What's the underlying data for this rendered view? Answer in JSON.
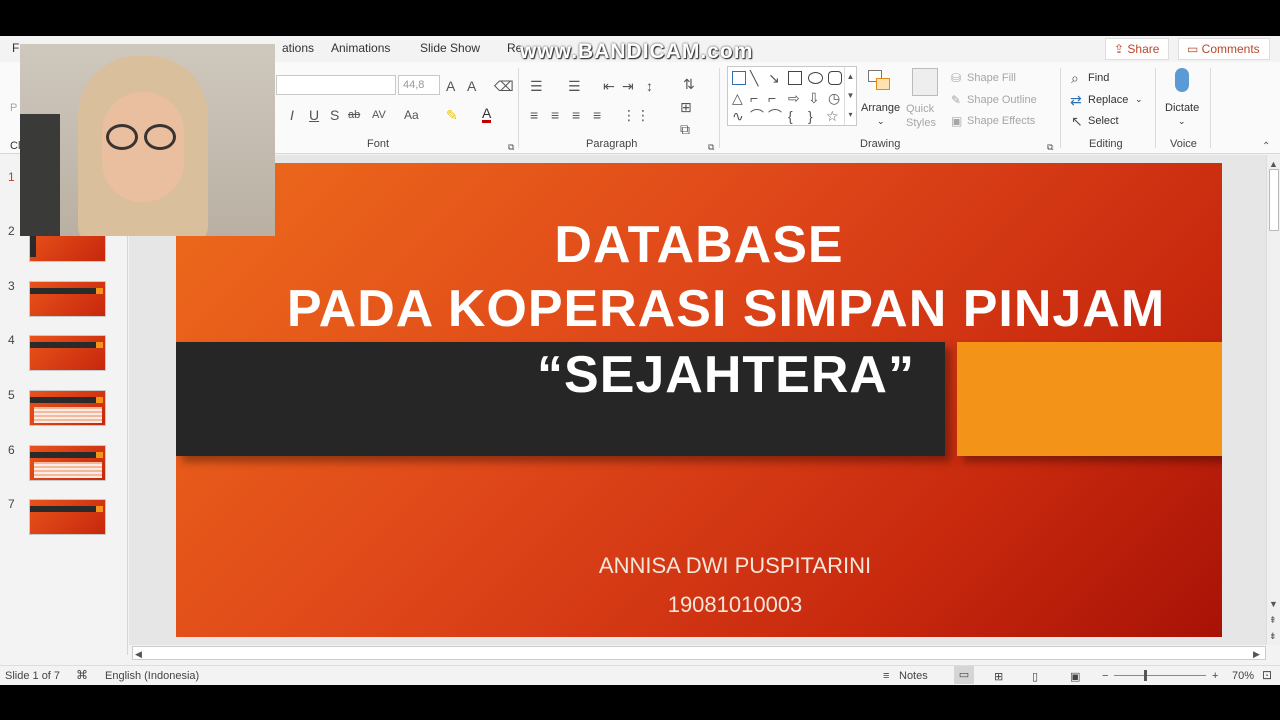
{
  "watermark": "www.BANDICAM.com",
  "tabs": [
    "F",
    "ations",
    "Animations",
    "Slide Show",
    "Re"
  ],
  "header": {
    "share": "Share",
    "comments": "Comments"
  },
  "ribbon": {
    "font_size": "44,8",
    "groups": {
      "font": "Font",
      "paragraph": "Paragraph",
      "drawing": "Drawing",
      "editing": "Editing",
      "voice": "Voice"
    },
    "drawing": {
      "arrange": "Arrange",
      "quick_styles": "Quick Styles",
      "shape_fill": "Shape Fill",
      "shape_outline": "Shape Outline",
      "shape_effects": "Shape Effects"
    },
    "editing": {
      "find": "Find",
      "replace": "Replace",
      "select": "Select"
    },
    "voice": {
      "dictate": "Dictate"
    },
    "left_fragments": {
      "p": "P",
      "cl": "Cl"
    }
  },
  "thumbnails": {
    "numbers": [
      "1",
      "2",
      "3",
      "4",
      "5",
      "6",
      "7"
    ]
  },
  "slide": {
    "title_line1": "DATABASE",
    "title_line2": "PADA KOPERASI SIMPAN PINJAM",
    "title_line3": "“SEJAHTERA”",
    "author": "ANNISA DWI PUSPITARINI",
    "id": "19081010003"
  },
  "status": {
    "slide": "Slide 1 of 7",
    "language": "English (Indonesia)",
    "notes": "Notes",
    "zoom": "70%"
  },
  "colors": {
    "accent": "#b7472a",
    "slide_orange": "#e0491a",
    "slide_box": "#f39418",
    "slide_bar": "#262626"
  }
}
